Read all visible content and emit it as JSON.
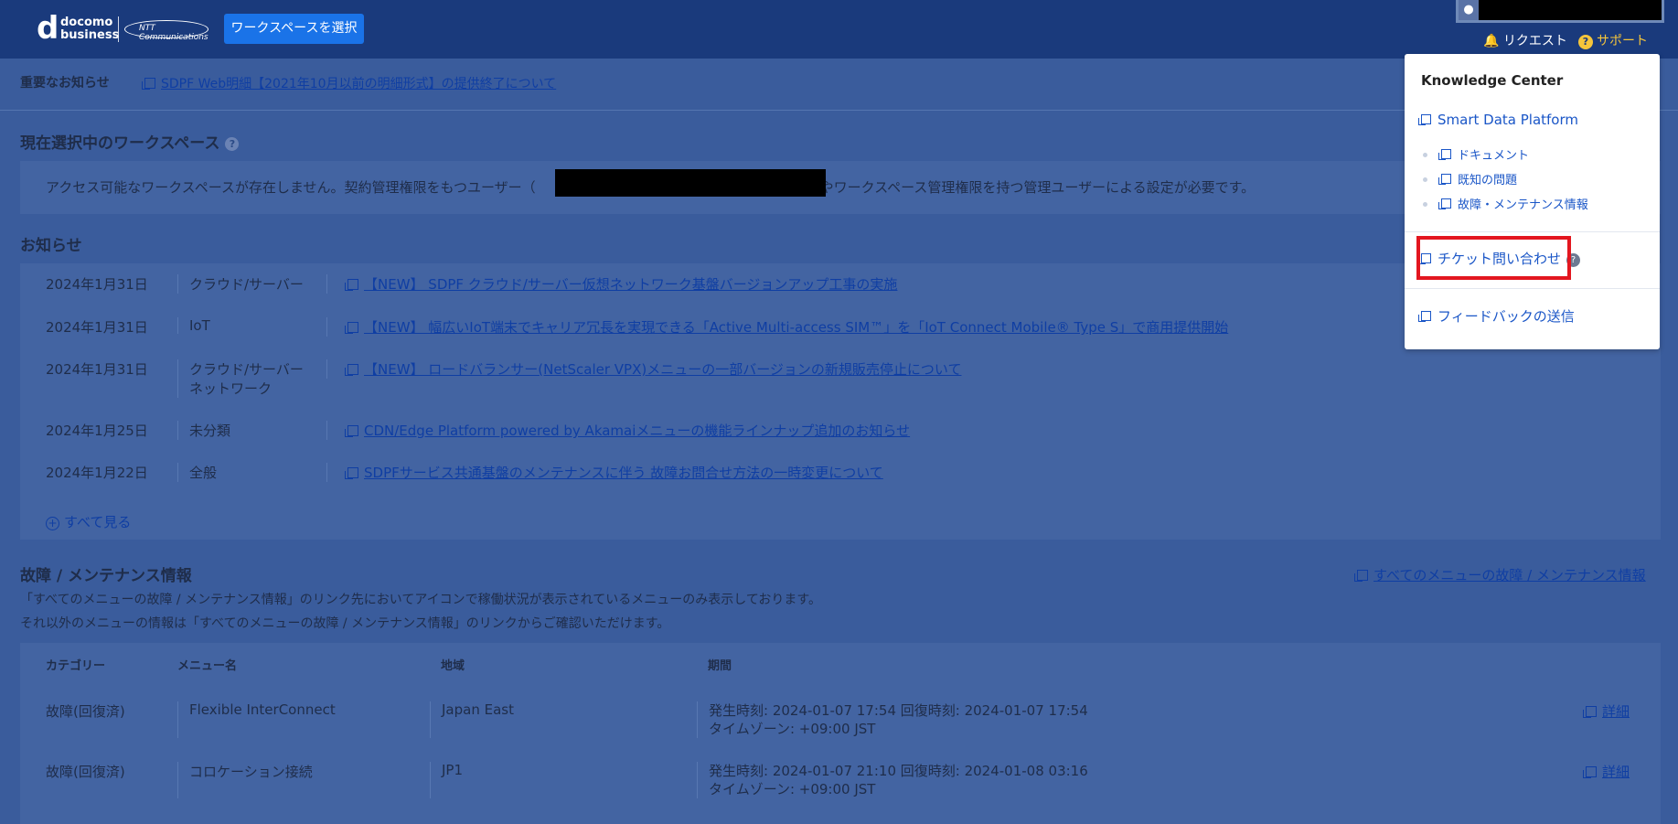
{
  "header": {
    "logo": {
      "brand": "docomo",
      "brand2": "business",
      "partner": "NTT Communications"
    },
    "workspace_button": "ワークスペースを選択",
    "request_label": "リクエスト",
    "support_label": "サポート"
  },
  "important_notice": {
    "title": "重要なお知らせ",
    "link": "SDPF Web明細【2021年10月以前の明細形式】の提供終了について"
  },
  "workspace": {
    "title": "現在選択中のワークスペース",
    "message_before": "アクセス可能なワークスペースが存在しません。契約管理権限をもつユーザー（",
    "message_after": "）やワークスペース管理権限を持つ管理ユーザーによる設定が必要です。"
  },
  "news": {
    "title": "お知らせ",
    "items": [
      {
        "date": "2024年1月31日",
        "category": "クラウド/サーバー",
        "title": "【NEW】 SDPF クラウド/サーバー仮想ネットワーク基盤バージョンアップ工事の実施"
      },
      {
        "date": "2024年1月31日",
        "category": "IoT",
        "title": "【NEW】 幅広いIoT端末でキャリア冗長を実現できる「Active Multi-access SIM™」を「IoT Connect Mobile® Type S」で商用提供開始"
      },
      {
        "date": "2024年1月31日",
        "category": "クラウド/サーバー",
        "category2": "ネットワーク",
        "title": "【NEW】 ロードバランサー(NetScaler VPX)メニューの一部バージョンの新規販売停止について"
      },
      {
        "date": "2024年1月25日",
        "category": "未分類",
        "title": "CDN/Edge Platform powered by Akamaiメニューの機能ラインナップ追加のお知らせ"
      },
      {
        "date": "2024年1月22日",
        "category": "全般",
        "title": "SDPFサービス共通基盤のメンテナンスに伴う 故障お問合せ方法の一時変更について"
      }
    ],
    "see_all": "すべて見る"
  },
  "maintenance": {
    "title": "故障 / メンテナンス情報",
    "all_link": "すべてのメニューの故障 / メンテナンス情報",
    "desc1": "「すべてのメニューの故障 / メンテナンス情報」のリンク先においてアイコンで稼働状況が表示されているメニューのみ表示しております。",
    "desc2": "それ以外のメニューの情報は「すべてのメニューの故障 / メンテナンス情報」のリンクからご確認いただけます。",
    "columns": [
      "カテゴリー",
      "メニュー名",
      "地域",
      "期間"
    ],
    "rows": [
      {
        "category": "故障(回復済)",
        "menu": "Flexible InterConnect",
        "region": "Japan East",
        "period1": "発生時刻: 2024-01-07 17:54 回復時刻: 2024-01-07 17:54",
        "period2": "タイムゾーン: +09:00 JST",
        "detail": "詳細"
      },
      {
        "category": "故障(回復済)",
        "menu": "コロケーション接続",
        "region": "JP1",
        "period1": "発生時刻: 2024-01-07 21:10 回復時刻: 2024-01-08 03:16",
        "period2": "タイムゾーン: +09:00 JST",
        "detail": "詳細"
      }
    ]
  },
  "support_dropdown": {
    "title": "Knowledge Center",
    "smart_data_platform": "Smart Data Platform",
    "sub_items": [
      "ドキュメント",
      "既知の問題",
      "故障・メンテナンス情報"
    ],
    "ticket": "チケット問い合わせ",
    "feedback": "フィードバックの送信"
  }
}
